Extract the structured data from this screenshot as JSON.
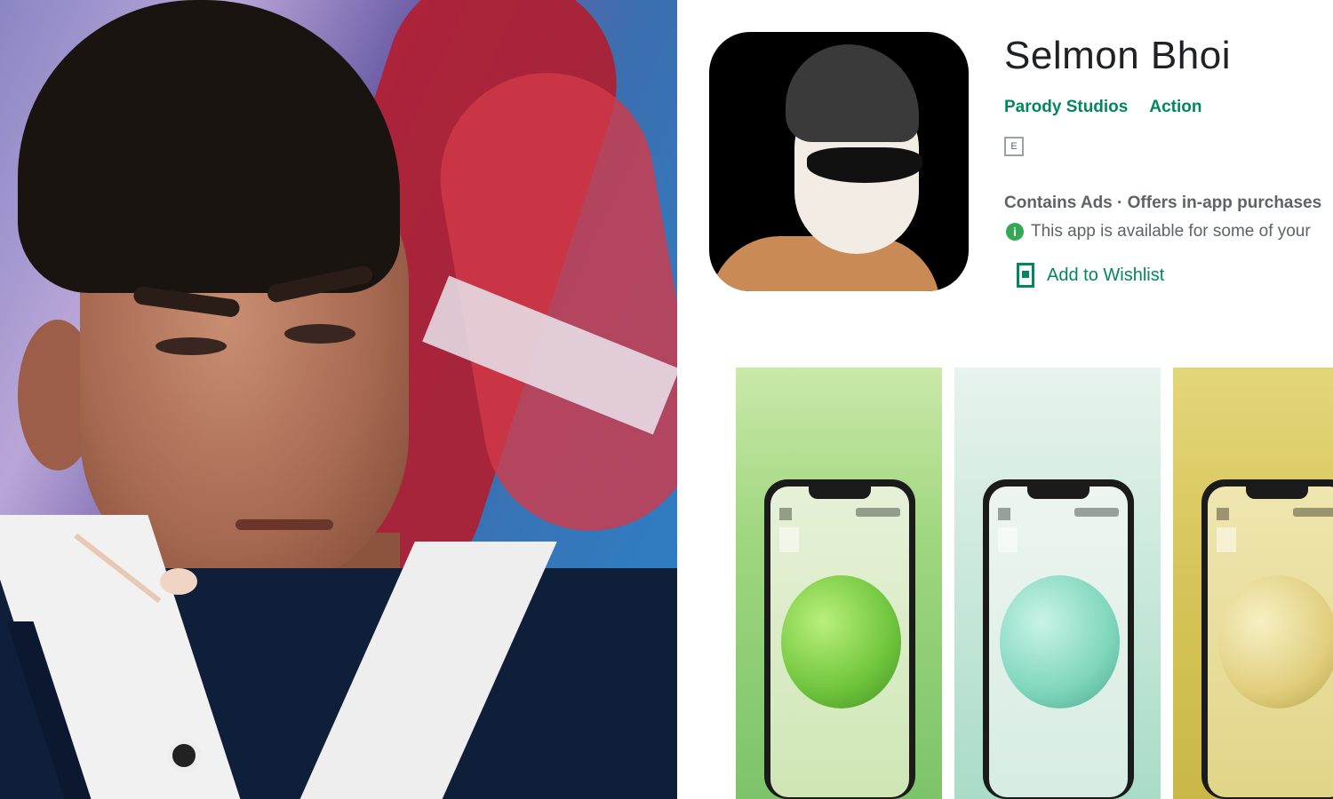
{
  "app": {
    "title": "Selmon Bhoi",
    "developer": "Parody Studios",
    "category": "Action",
    "content_rating_badge": "E",
    "monetization": "Contains Ads · Offers in-app purchases",
    "availability": "This app is available for some of your",
    "wishlist_label": "Add to Wishlist"
  },
  "icons": {
    "info": "i"
  },
  "colors": {
    "accent_green": "#01875f",
    "text_primary": "#202124",
    "text_secondary": "#5f6368",
    "screenshot1_bg": "#a6d88a",
    "screenshot2_bg": "#bfe7d6",
    "screenshot3_bg": "#d9c75a"
  }
}
